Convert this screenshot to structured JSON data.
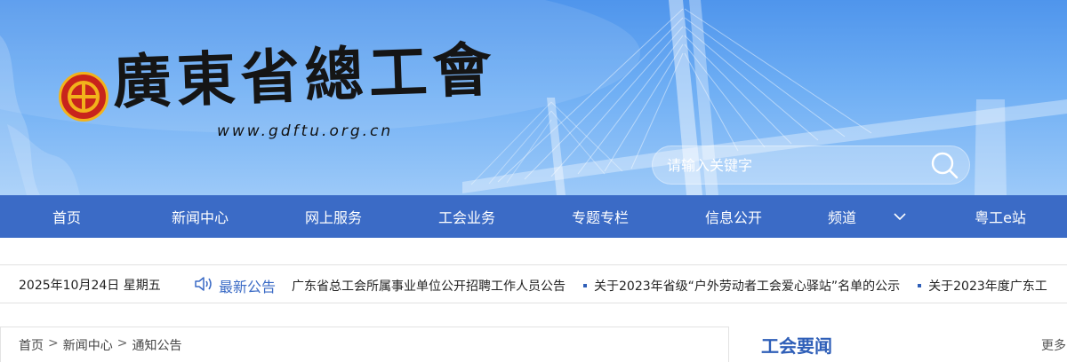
{
  "header": {
    "logo_text": "廣東省總工會",
    "site_url": "www.gdftu.org.cn",
    "search": {
      "placeholder": "请输入关键字"
    }
  },
  "nav": {
    "items": [
      {
        "label": "首页"
      },
      {
        "label": "新闻中心"
      },
      {
        "label": "网上服务"
      },
      {
        "label": "工会业务"
      },
      {
        "label": "专题专栏"
      },
      {
        "label": "信息公开"
      },
      {
        "label": "频道"
      },
      {
        "label": "粤工e站"
      }
    ]
  },
  "notice_bar": {
    "date": "2025年10月24日 星期五",
    "label": "最新公告",
    "items": [
      "广东省总工会所属事业单位公开招聘工作人员公告",
      "关于2023年省级“户外劳动者工会爱心驿站”名单的公示",
      "关于2023年度广东工"
    ]
  },
  "breadcrumb": [
    "首页",
    "新闻中心",
    "通知公告"
  ],
  "sidebar": {
    "title": "工会要闻",
    "more": "更多"
  },
  "colors": {
    "nav_bg": "#3b6bc6",
    "accent": "#3a6ac5",
    "logo_red": "#c8241c",
    "logo_gold": "#f2b31b"
  },
  "icons": [
    "search-icon",
    "chevron-down-icon",
    "speaker-icon",
    "union-emblem-icon"
  ]
}
